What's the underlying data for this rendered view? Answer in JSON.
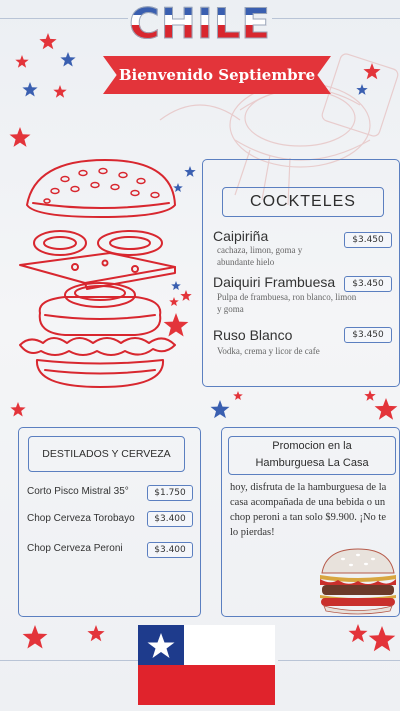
{
  "header": {
    "title": "CHILE",
    "banner": "Bienvenido Septiembre"
  },
  "cocktails": {
    "heading": "COCKTELES",
    "items": [
      {
        "name": "Caipiriña",
        "description": "cachaza, limon, goma y abundante hielo",
        "price": "$3.450"
      },
      {
        "name": "Daiquiri Frambuesa",
        "description": "Pulpa de frambuesa, ron blanco, limon y goma",
        "price": "$3.450"
      },
      {
        "name": "Ruso Blanco",
        "description": "Vodka, crema y licor de cafe",
        "price": "$3.450"
      }
    ]
  },
  "spirits": {
    "heading": "DESTILADOS Y CERVEZA",
    "items": [
      {
        "name": "Corto Pisco Mistral 35°",
        "price": "$1.750"
      },
      {
        "name": "Chop Cerveza Torobayo",
        "price": "$3.400"
      },
      {
        "name": "Chop Cerveza Peroni",
        "price": "$3.400"
      }
    ]
  },
  "promo": {
    "heading_line1": "Promocion en la",
    "heading_line2": "Hamburguesa La Casa",
    "body": "hoy, disfruta de la hamburguesa de la casa acompañada de una bebida o un chop peroni a tan solo $9.900. ¡No te lo pierdas!"
  },
  "colors": {
    "red": "#e3343a",
    "blue": "#3a5fb0",
    "frame": "#5b7fc0"
  },
  "icons": [
    "star-icon",
    "burger-illustration",
    "chile-flag-icon",
    "burger-photo"
  ]
}
